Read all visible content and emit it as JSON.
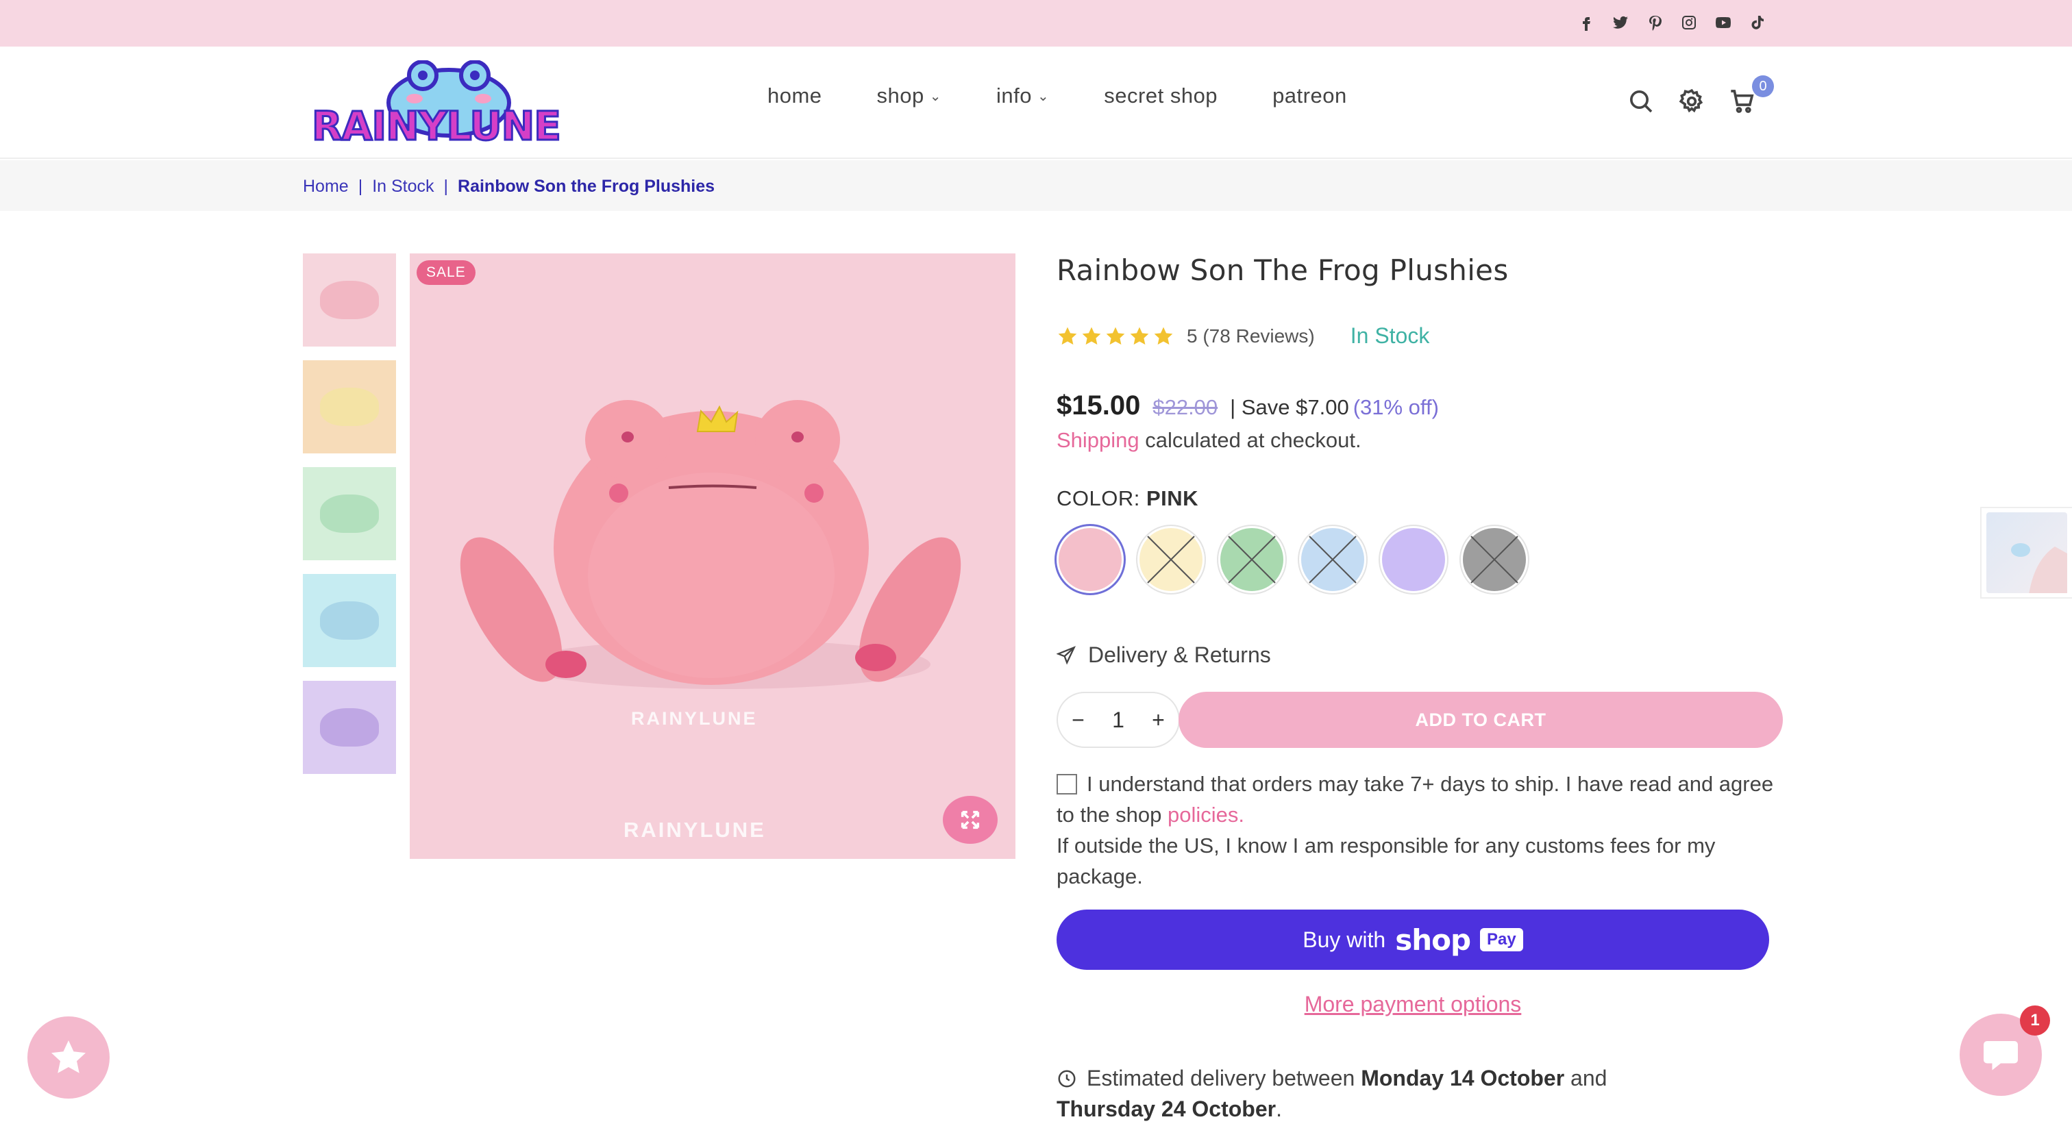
{
  "topbar": {
    "social_icons": [
      "facebook-icon",
      "twitter-icon",
      "pinterest-icon",
      "instagram-icon",
      "youtube-icon",
      "tiktok-icon"
    ]
  },
  "header": {
    "logo_text": "RAINYLUNE",
    "nav": [
      {
        "label": "home",
        "has_dropdown": false
      },
      {
        "label": "shop",
        "has_dropdown": true
      },
      {
        "label": "info",
        "has_dropdown": true
      },
      {
        "label": "secret shop",
        "has_dropdown": false
      },
      {
        "label": "patreon",
        "has_dropdown": false
      }
    ],
    "cart_count": "0"
  },
  "breadcrumb": {
    "items": [
      "Home",
      "In Stock",
      "Rainbow Son the Frog Plushies"
    ]
  },
  "gallery": {
    "badge": "SALE",
    "watermark_1": "RAINYLUNE",
    "watermark_2": "RAINYLUNE",
    "thumbnails": [
      {
        "bg": "#f6d6dd",
        "frog": "#f2b7c3"
      },
      {
        "bg": "#f7dcb9",
        "frog": "#f4e3a5"
      },
      {
        "bg": "#d4efd9",
        "frog": "#b2e0bd"
      },
      {
        "bg": "#c6ecf2",
        "frog": "#a9d6e8"
      },
      {
        "bg": "#dcccf2",
        "frog": "#bfa7e4"
      }
    ],
    "main_bg": "#f6cfd9"
  },
  "product": {
    "title": "Rainbow Son The Frog Plushies",
    "rating_value": 5,
    "rating_text": "5 (78 Reviews)",
    "stock": "In Stock",
    "price": "$15.00",
    "compare_price": "$22.00",
    "save_text": "| Save $7.00",
    "save_pct": "(31% off)",
    "shipping_link": "Shipping",
    "shipping_text": " calculated at checkout.",
    "color_label": "COLOR: ",
    "color_value": "PINK",
    "swatches": [
      {
        "name": "pink",
        "color": "#f4bfca",
        "available": true,
        "selected": true
      },
      {
        "name": "yellow",
        "color": "#fbefc8",
        "available": false,
        "selected": false
      },
      {
        "name": "green",
        "color": "#a9d9af",
        "available": false,
        "selected": false
      },
      {
        "name": "blue",
        "color": "#c4dcf3",
        "available": false,
        "selected": false
      },
      {
        "name": "purple",
        "color": "#cbbcf6",
        "available": true,
        "selected": false
      },
      {
        "name": "gray",
        "color": "#9e9e9e",
        "available": false,
        "selected": false
      }
    ],
    "delivery_returns": "Delivery & Returns",
    "quantity": "1",
    "qty_minus": "−",
    "qty_plus": "+",
    "add_to_cart": "ADD TO CART",
    "agree_text_1": "I understand that orders may take 7+ days to ship. I have read and agree to the shop ",
    "agree_link": "policies.",
    "agree_text_2": "If outside the US, I know I am responsible for any customs fees for my package.",
    "buy_with": "Buy with",
    "shop_brand": "shop",
    "pay_badge": "Pay",
    "more_payment": "More payment options",
    "est_prefix": "Estimated delivery between ",
    "est_start": "Monday 14 October",
    "est_mid": " and ",
    "est_end": "Thursday 24 October",
    "est_suffix": "."
  },
  "widgets": {
    "chat_badge": "1"
  }
}
